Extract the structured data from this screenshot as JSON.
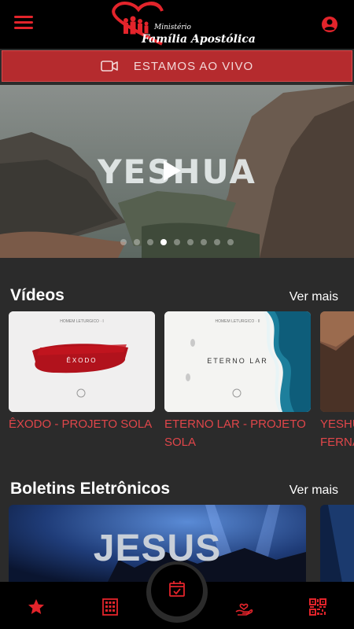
{
  "header": {
    "logo_line1": "Ministério",
    "logo_line2": "Família Apostólica",
    "menu_icon": "hamburger-menu-icon",
    "profile_icon": "account-circle-icon"
  },
  "live": {
    "label": "ESTAMOS AO VIVO",
    "icon": "video-camera-icon"
  },
  "banner": {
    "title": "YESHUA",
    "slides_count": 9,
    "active_slide": 3
  },
  "videos": {
    "title": "Vídeos",
    "see_more": "Ver mais",
    "items": [
      {
        "caption": "ÊXODO - PROJETO SOLA",
        "thumb_title": "ÊXODO",
        "thumb_sub": "HOMEM LETURGICO · I"
      },
      {
        "caption": "ETERNO LAR - PROJETO SOLA",
        "thumb_title": "ETERNO LAR",
        "thumb_sub": "HOMEM LETURGICO · II"
      },
      {
        "caption": "YESHUA FERNA"
      }
    ]
  },
  "bulletins": {
    "title": "Boletins Eletrônicos",
    "see_more": "Ver mais",
    "items": [
      {
        "thumb_title": "JESUS"
      }
    ]
  },
  "bottom_nav": {
    "items": [
      "star-icon",
      "building-icon",
      "calendar-check-icon",
      "hand-heart-icon",
      "qr-code-icon"
    ]
  },
  "colors": {
    "accent": "#e3242b",
    "live_bg": "#b52b2e",
    "bg": "#2b2b2b",
    "bar": "#000000"
  }
}
